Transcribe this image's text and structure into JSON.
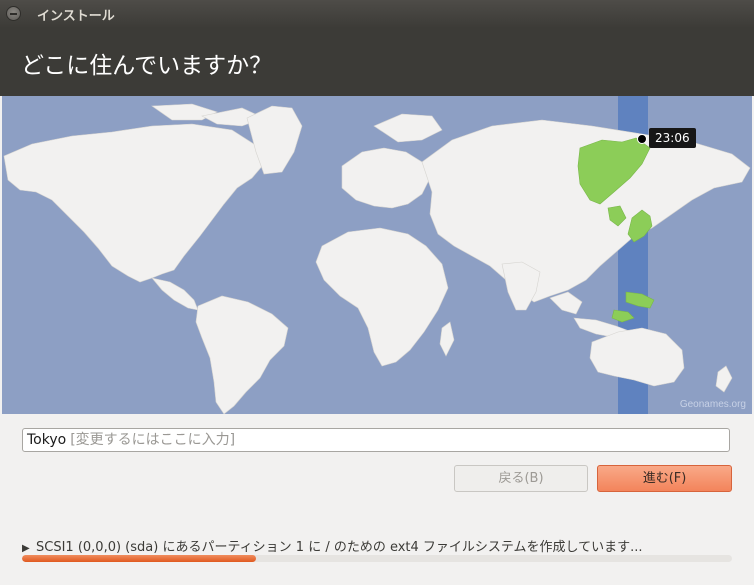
{
  "window": {
    "title": "インストール"
  },
  "page": {
    "heading": "どこに住んでいますか？"
  },
  "map": {
    "credit": "Geonames.org",
    "selected_time": "23:06"
  },
  "location": {
    "value": "Tokyo",
    "placeholder": "[変更するにはここに入力]"
  },
  "buttons": {
    "back_label": "戻る(B)",
    "forward_label": "進む(F)"
  },
  "status": {
    "message": "SCSI1 (0,0,0) (sda) にあるパーティション 1 に / のための ext4 ファイルシステムを作成しています...",
    "progress_fraction": 0.33
  },
  "colors": {
    "accent": "#f3845b",
    "ocean": "#8d9fc4",
    "land": "#f2f1f0",
    "timezone_band": "#5f82bf",
    "selected_zone": "#8ccd58"
  }
}
